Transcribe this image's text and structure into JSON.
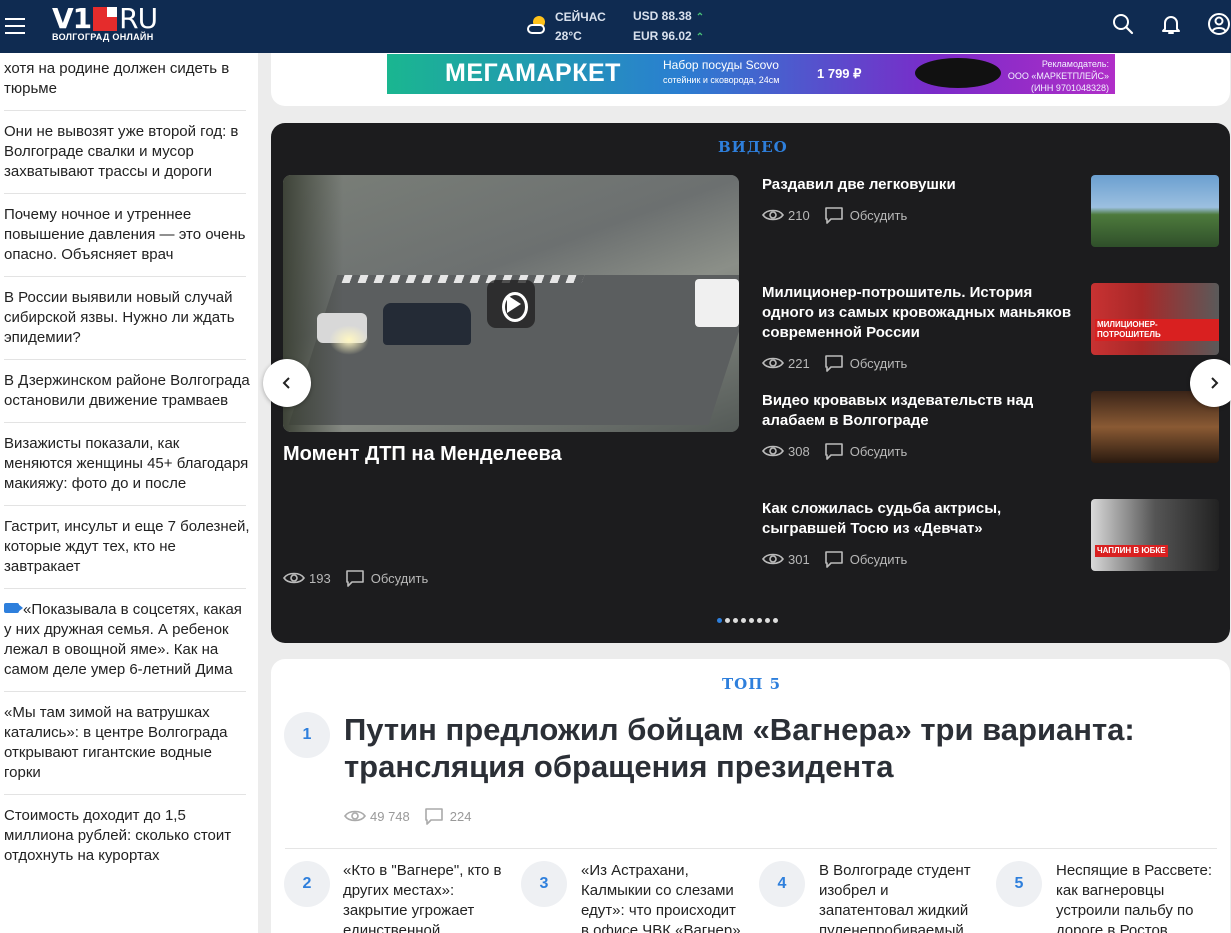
{
  "header": {
    "logo_main": "V1",
    "logo_ru": "RU",
    "logo_sub": "ВОЛГОГРАД ОНЛАЙН",
    "weather_label": "СЕЙЧАС",
    "weather_temp": "28°C",
    "usd": "USD 88.38",
    "eur": "EUR 96.02",
    "up_arrow": "^"
  },
  "sidebar": {
    "items": [
      {
        "text": "хотя на родине должен сидеть в тюрьме"
      },
      {
        "text": "Они не вывозят уже второй год: в Волгограде свалки и мусор захватывают трассы и дороги"
      },
      {
        "text": "Почему ночное и утреннее повышение давления — это очень опасно. Объясняет врач"
      },
      {
        "text": "В России выявили новый случай сибирской язвы. Нужно ли ждать эпидемии?"
      },
      {
        "text": "В Дзержинском районе Волгограда остановили движение трамваев"
      },
      {
        "text": "Визажисты показали, как меняются женщины 45+ благодаря макияжу: фото до и после"
      },
      {
        "text": "Гастрит, инсульт и еще 7 болезней, которые ждут тех, кто не завтракает"
      },
      {
        "text": "«Показывала в соцсетях, какая у них дружная семья. А ребенок лежал в овощной яме». Как на самом деле умер 6-летний Дима"
      },
      {
        "text": "«Мы там зимой на ватрушках катались»: в центре Волгограда открывают гигантские водные горки"
      },
      {
        "text": "Стоимость доходит до 1,5 миллиона рублей: сколько стоит отдохнуть на курортах"
      }
    ]
  },
  "ad": {
    "brand": "МЕГАМАРКЕТ",
    "product": "Набор посуды Scovo",
    "product_sub": "сотейник и сковорода, 24см",
    "price": "1 799 ₽",
    "legal1": "Рекламодатель:",
    "legal2": "ООО «МАРКЕТПЛЕЙС»",
    "legal3": "(ИНН 9701048328)"
  },
  "video": {
    "label": "ВИДЕО",
    "main_title": "Момент ДТП на Менделеева",
    "main_views": "193",
    "discuss": "Обсудить",
    "items": [
      {
        "title": "Раздавил две легковушки",
        "views": "210"
      },
      {
        "title": "Милиционер-потрошитель. История одного из самых кровожадных маньяков современной России",
        "views": "221",
        "tag": "МИЛИЦИОНЕР-ПОТРОШИТЕЛЬ"
      },
      {
        "title": "Видео кровавых издевательств над алабаем в Волгограде",
        "views": "308"
      },
      {
        "title": "Как сложилась судьба актрисы, сыгравшей Тосю из «Девчат»",
        "views": "301",
        "tag": "ЧАПЛИН В ЮБКЕ"
      }
    ]
  },
  "top5": {
    "label": "ТОП 5",
    "first": {
      "num": "1",
      "title": "Путин предложил бойцам «Вагнера» три варианта: трансляция обращения президента",
      "views": "49 748",
      "comments": "224"
    },
    "items": [
      {
        "num": "2",
        "title": "«Кто в \"Вагнере\", кто в других местах»: закрытие угрожает единственной"
      },
      {
        "num": "3",
        "title": "«Из Астрахани, Калмыкии со слезами едут»: что происходит в офисе ЧВК «Вагнер»"
      },
      {
        "num": "4",
        "title": "В Волгограде студент изобрел и запатентовал жидкий пуленепробиваемый"
      },
      {
        "num": "5",
        "title": "Неспящие в Рассвете: как вагнеровцы устроили пальбу по дороге в Ростов"
      }
    ]
  },
  "colors": {
    "header_bg": "#0f2b51",
    "accent": "#2e7fdc",
    "video_bg": "#1c1c1e"
  }
}
